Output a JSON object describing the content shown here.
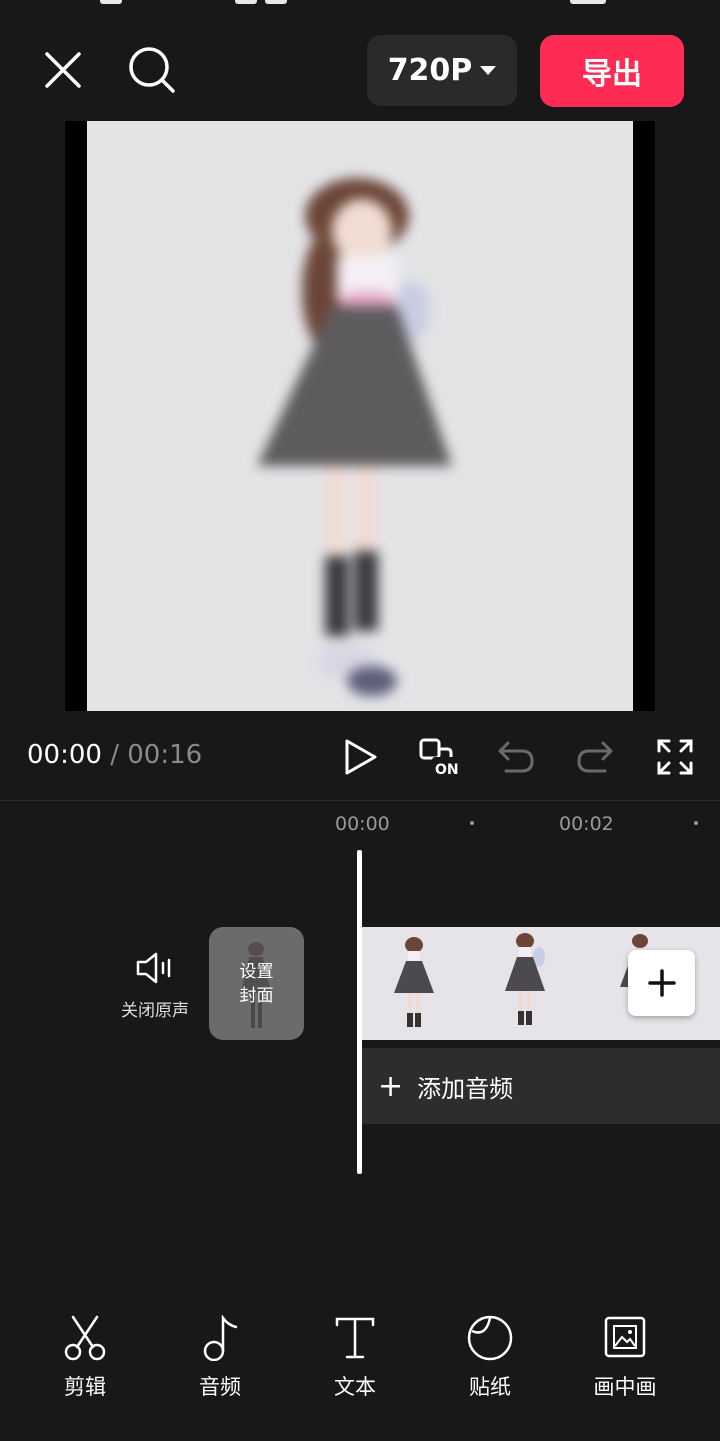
{
  "topbar": {
    "close_icon": "close-icon",
    "search_icon": "search-icon",
    "resolution": "720P",
    "export_label": "导出"
  },
  "player": {
    "current_time": "00:00",
    "separator": "/",
    "total_time": "00:16"
  },
  "timeline": {
    "ruler": [
      "00:00",
      "00:02"
    ],
    "mute_label": "关闭原声",
    "cover_label": "设置封面",
    "add_audio_label": "添加音频"
  },
  "toolbar": {
    "items": [
      {
        "label": "剪辑",
        "icon": "scissors-icon"
      },
      {
        "label": "音频",
        "icon": "music-note-icon"
      },
      {
        "label": "文本",
        "icon": "text-icon"
      },
      {
        "label": "贴纸",
        "icon": "sticker-icon"
      },
      {
        "label": "画中画",
        "icon": "picture-in-picture-icon"
      }
    ]
  },
  "colors": {
    "accent": "#fe2c55",
    "background": "#181818"
  }
}
